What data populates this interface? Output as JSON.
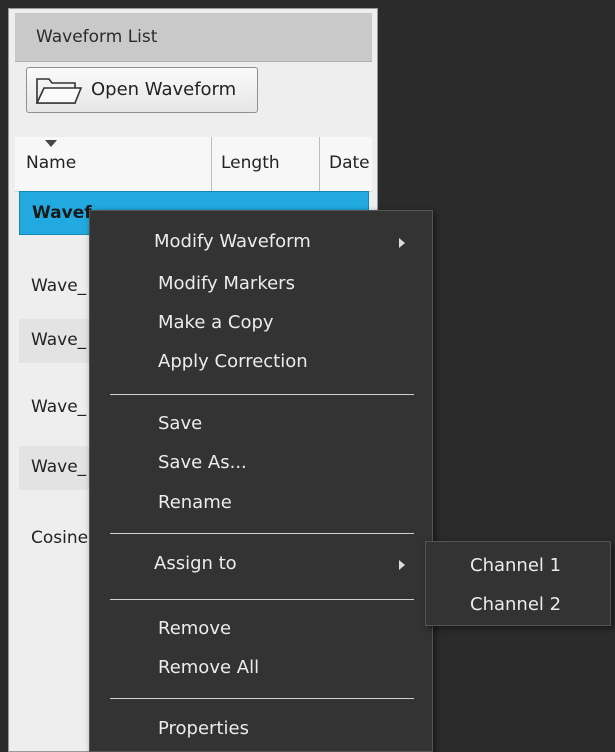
{
  "panel": {
    "title": "Waveform List",
    "open_button_label": "Open Waveform"
  },
  "table": {
    "columns": [
      "Name",
      "Length",
      "Date"
    ],
    "rows": [
      "Wavef",
      "Wave_",
      "Wave_",
      "Wave_",
      "Wave_",
      "Cosine"
    ]
  },
  "context_menu": {
    "items": [
      "Modify Waveform",
      "Modify Markers",
      "Make a Copy",
      "Apply Correction",
      "Save",
      "Save As...",
      "Rename",
      "Assign to",
      "Remove",
      "Remove All",
      "Properties"
    ],
    "submenu": [
      "Channel 1",
      "Channel 2"
    ]
  },
  "colors": {
    "selection": "#21a9e0",
    "menu_background": "#333333",
    "panel_background": "#eeeeee"
  },
  "icons": [
    "folder-icon",
    "sort-arrow-icon",
    "submenu-arrow-icon"
  ]
}
